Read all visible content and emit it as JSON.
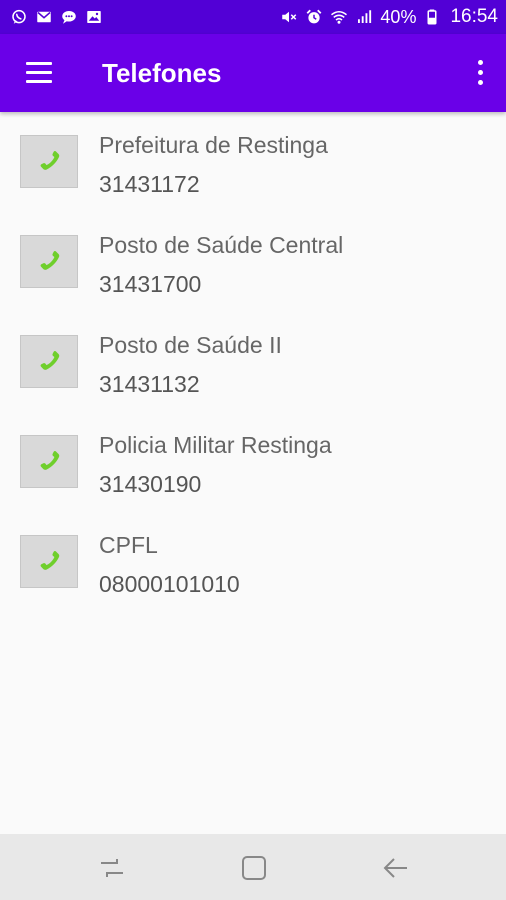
{
  "status_bar": {
    "battery": "40%",
    "time": "16:54",
    "left_icons": [
      "whatsapp-icon",
      "mail-icon",
      "chat-icon",
      "image-icon"
    ],
    "right_icons": [
      "mute-icon",
      "alarm-icon",
      "wifi-icon",
      "signal-icon",
      "battery-icon"
    ]
  },
  "app_bar": {
    "title": "Telefones",
    "menu_icon": "hamburger-menu-icon",
    "overflow_icon": "more-vert-icon",
    "color": "#6a00e8"
  },
  "contacts": [
    {
      "name": "Prefeitura de Restinga",
      "number": "31431172"
    },
    {
      "name": "Posto de Saúde Central",
      "number": "31431700"
    },
    {
      "name": "Posto de Saúde II",
      "number": "31431132"
    },
    {
      "name": "Policia Militar Restinga",
      "number": "31430190"
    },
    {
      "name": "CPFL",
      "number": "08000101010"
    }
  ],
  "contact_icon": "phone-icon",
  "nav_bar": {
    "buttons": [
      "recents-icon",
      "home-icon",
      "back-icon"
    ]
  }
}
